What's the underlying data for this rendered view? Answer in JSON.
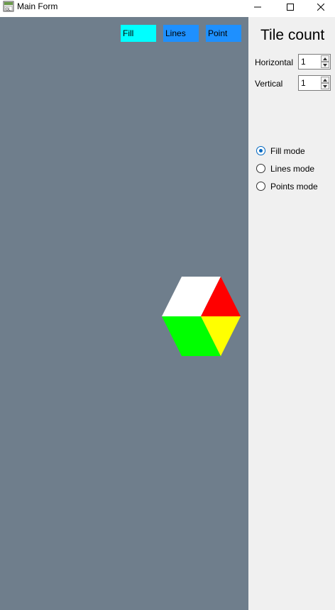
{
  "window": {
    "title": "Main Form",
    "icon": "gl-app-icon"
  },
  "canvas": {
    "background": "#6f7e8c",
    "buttons": {
      "fill": "Fill",
      "lines": "Lines",
      "point": "Point"
    },
    "shape_colors": {
      "top": "#ffffff",
      "right_top": "#ff0000",
      "bottom_left": "#00ff00",
      "right_bottom": "#ffff00"
    }
  },
  "panel": {
    "title": "Tile count",
    "horizontal_label": "Horizontal",
    "horizontal_value": "1",
    "vertical_label": "Vertical",
    "vertical_value": "1",
    "modes": [
      {
        "label": "Fill mode",
        "checked": true
      },
      {
        "label": "Lines mode",
        "checked": false
      },
      {
        "label": "Points mode",
        "checked": false
      }
    ]
  }
}
